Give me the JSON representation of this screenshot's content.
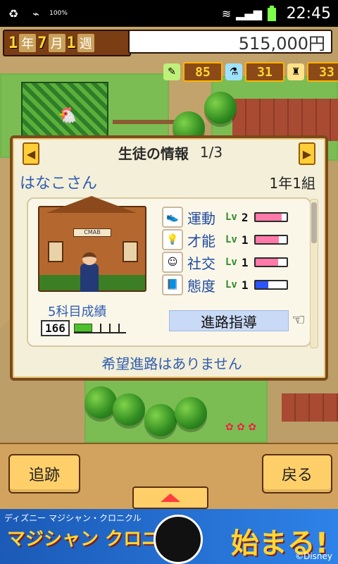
{
  "status_bar": {
    "icons": [
      "recycle-icon",
      "usb-icon",
      "battery-100-icon",
      "wifi-icon",
      "signal-icon",
      "battery-icon"
    ],
    "battery_small_text": "100%",
    "time": "22:45"
  },
  "hud": {
    "date": {
      "year_num": "1",
      "year_label": "年",
      "month_num": "7",
      "month_label": "月",
      "week_num": "1",
      "week_label": "週"
    },
    "money": "515,000円",
    "stats": [
      {
        "icon": "pencil-icon",
        "value": "85"
      },
      {
        "icon": "flask-icon",
        "value": "31"
      },
      {
        "icon": "bell-icon",
        "value": "33"
      }
    ]
  },
  "dialog": {
    "title": "生徒の情報",
    "page": "1/3",
    "student_name": "はなこさん",
    "class_label": "1年1組",
    "house_sign": "CMAB",
    "grades_label": "5科目成績",
    "grades_score": "166",
    "grades_progress": 0.35,
    "attributes": [
      {
        "name": "運動",
        "lv_label": "Lv",
        "lv": "2",
        "icon": "shoe-icon",
        "meter": 0.85,
        "color": "#ff7aa8"
      },
      {
        "name": "才能",
        "lv_label": "Lv",
        "lv": "1",
        "icon": "lightbulb-icon",
        "meter": 0.75,
        "color": "#ff7aa8"
      },
      {
        "name": "社交",
        "lv_label": "Lv",
        "lv": "1",
        "icon": "smile-icon",
        "meter": 0.72,
        "color": "#ff7aa8"
      },
      {
        "name": "態度",
        "lv_label": "Lv",
        "lv": "1",
        "icon": "book-icon",
        "meter": 0.42,
        "color": "#2b55ff"
      }
    ],
    "career_button": "進路指導",
    "no_career_text": "希望進路はありません"
  },
  "bottom": {
    "left_button": "追跡",
    "right_button": "戻る"
  },
  "ad": {
    "line1": "ディズニー マジシャン・クロニクル",
    "line2": "マジシャン クロニクル",
    "cta": "始まる!",
    "brand": "©Disney"
  }
}
